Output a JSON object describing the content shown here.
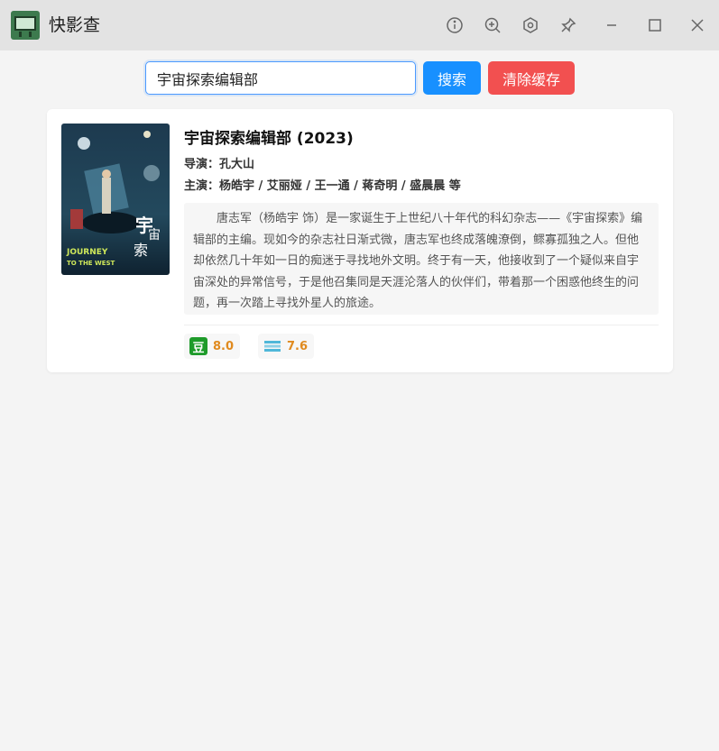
{
  "app": {
    "title": "快影查"
  },
  "titlebar": {
    "buttons": [
      "info-icon",
      "zoom-in-icon",
      "settings-icon",
      "pin-icon",
      "minimize-icon",
      "maximize-icon",
      "close-icon"
    ]
  },
  "search": {
    "value": "宇宙探索编辑部",
    "search_label": "搜索",
    "clear_cache_label": "清除缓存"
  },
  "result": {
    "title": "宇宙探索编辑部 (2023)",
    "director": "导演：孔大山",
    "cast": "主演：杨皓宇 / 艾丽娅 / 王一通 / 蒋奇明 / 盛晨晨 等",
    "synopsis": "唐志军（杨皓宇 饰）是一家诞生于上世纪八十年代的科幻杂志——《宇宙探索》编辑部的主编。现如今的杂志社日渐式微，唐志军也终成落魄潦倒，鳏寡孤独之人。但他却依然几十年如一日的痴迷于寻找地外文明。终于有一天，他接收到了一个疑似来自宇宙深处的异常信号，于是他召集同是天涯沦落人的伙伴们，带着那一个困惑他终生的问题，再一次踏上寻找外星人的旅途。",
    "poster": {
      "title_text": "宇宙探索编辑部",
      "english_title": "JOURNEY TO THE WEST"
    },
    "ratings": [
      {
        "source_icon": "douban-icon",
        "icon_text": "豆",
        "score": "8.0"
      },
      {
        "source_icon": "maoyan-icon",
        "score": "7.6"
      }
    ]
  },
  "colors": {
    "primary": "#1890ff",
    "danger": "#f25050",
    "score": "#e08a1e",
    "douban": "#1e9b2a"
  }
}
